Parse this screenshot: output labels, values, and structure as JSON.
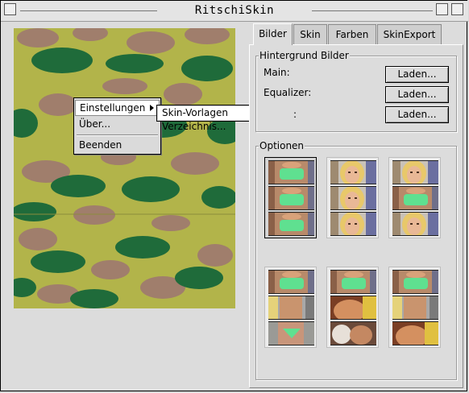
{
  "window": {
    "title": "RitschiSkin"
  },
  "menu": {
    "items": [
      {
        "label": "Einstellungen",
        "has_submenu": true
      },
      {
        "label": "Über..."
      },
      {
        "label": "Beenden"
      }
    ],
    "submenu": {
      "label": "Skin-Vorlagen Verzeichnis..."
    }
  },
  "tabs": [
    {
      "label": "Bilder",
      "active": true
    },
    {
      "label": "Skin"
    },
    {
      "label": "Farben"
    },
    {
      "label": "SkinExport"
    }
  ],
  "background_group": {
    "title": "Hintergrund Bilder",
    "rows": [
      {
        "label": "Main:",
        "button": "Laden..."
      },
      {
        "label": "Equalizer:",
        "button": "Laden..."
      },
      {
        "label": ":",
        "button": "Laden..."
      }
    ]
  },
  "options_group": {
    "title": "Optionen"
  },
  "colors": {
    "camo_base": "#b2b44a",
    "camo_green": "#1f6b3a",
    "camo_brown": "#a07e6c",
    "swimsuit_green": "#5fe090"
  },
  "thumbnails": [
    {
      "selected": true,
      "frames": [
        "top-swimsuit",
        "top-swimsuit",
        "top-swimsuit"
      ]
    },
    {
      "selected": false,
      "frames": [
        "face-blonde",
        "face-blonde",
        "face-blonde"
      ]
    },
    {
      "selected": false,
      "frames": [
        "face-blonde",
        "top-swimsuit",
        "face-blonde"
      ]
    },
    {
      "selected": false,
      "frames": [
        "top-swimsuit",
        "torso",
        "bikini-bottom"
      ]
    },
    {
      "selected": false,
      "frames": [
        "top-swimsuit",
        "closeup-warm",
        "closeup-face"
      ]
    },
    {
      "selected": false,
      "frames": [
        "top-swimsuit",
        "torso",
        "closeup-warm"
      ]
    }
  ]
}
